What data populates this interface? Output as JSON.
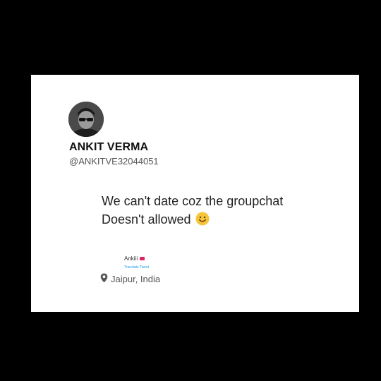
{
  "profile": {
    "name": "ANKIT VERMA",
    "handle": "@ANKITVE32044051",
    "avatar_icon": "profile-photo-sunglasses"
  },
  "tweet": {
    "line1": "We can't date coz the groupchat",
    "line2": "Doesn't allowed",
    "emoji_icon": "slightly-smiling-face-emoji"
  },
  "embedded": {
    "name": "Ankiii",
    "translate": "Translate Tweet",
    "location": "Jaipur, India",
    "location_icon": "location-pin-icon"
  },
  "colors": {
    "background": "#000000",
    "card": "#ffffff",
    "link": "#1d9bf0"
  }
}
